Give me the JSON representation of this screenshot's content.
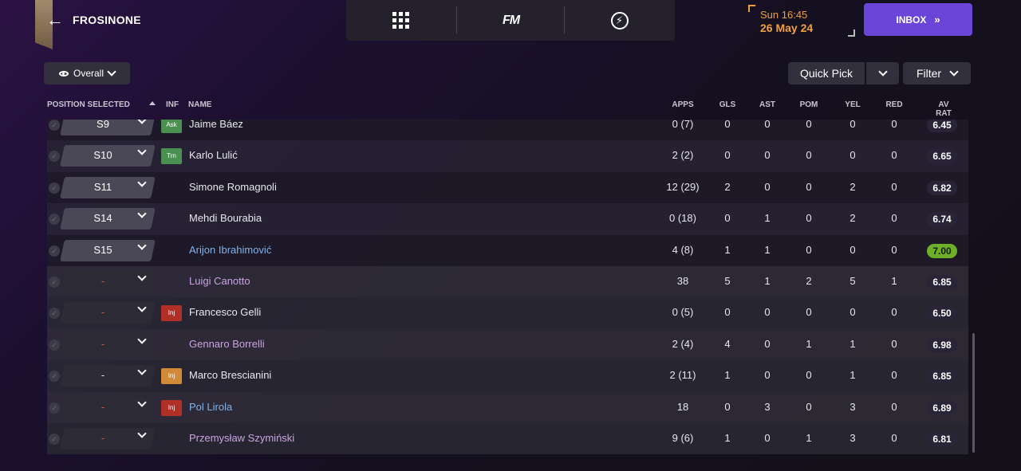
{
  "header": {
    "back_icon": "back-arrow-icon",
    "club_name": "FROSINONE",
    "nav": {
      "grid_icon": "grid-menu-icon",
      "logo": "FM",
      "bolt_icon": "lightning-icon"
    },
    "date_time": "Sun 16:45",
    "date_day": "26 May 24",
    "inbox_label": "INBOX",
    "colors": {
      "accent": "#6a45d8",
      "date": "#f0a040"
    }
  },
  "toolbar": {
    "view_label": "Overall",
    "quick_pick_label": "Quick Pick",
    "filter_label": "Filter"
  },
  "table": {
    "columns": {
      "position": "POSITION SELECTED",
      "inf": "INF",
      "name": "NAME",
      "apps": "APPS",
      "gls": "GLS",
      "ast": "AST",
      "pom": "POM",
      "yel": "YEL",
      "red": "RED",
      "avrat": "AV RAT"
    },
    "rows": [
      {
        "pos": "S9",
        "inf": "Ask",
        "name": "Jaime Báez",
        "apps": "0 (7)",
        "gls": "0",
        "ast": "0",
        "pom": "0",
        "yel": "0",
        "red": "0",
        "rat": "6.45"
      },
      {
        "pos": "S10",
        "inf": "Trn",
        "name": "Karlo Lulić",
        "apps": "2 (2)",
        "gls": "0",
        "ast": "0",
        "pom": "0",
        "yel": "0",
        "red": "0",
        "rat": "6.65"
      },
      {
        "pos": "S11",
        "inf": "",
        "name": "Simone Romagnoli",
        "apps": "12 (29)",
        "gls": "2",
        "ast": "0",
        "pom": "0",
        "yel": "2",
        "red": "0",
        "rat": "6.82"
      },
      {
        "pos": "S14",
        "inf": "",
        "name": "Mehdi Bourabia",
        "apps": "0 (18)",
        "gls": "0",
        "ast": "1",
        "pom": "0",
        "yel": "2",
        "red": "0",
        "rat": "6.74"
      },
      {
        "pos": "S15",
        "inf": "",
        "name": "Arijon Ibrahimović",
        "apps": "4 (8)",
        "gls": "1",
        "ast": "1",
        "pom": "0",
        "yel": "0",
        "red": "0",
        "rat": "7.00"
      },
      {
        "pos": "-",
        "inf": "",
        "name": "Luigi Canotto",
        "apps": "38",
        "gls": "5",
        "ast": "1",
        "pom": "2",
        "yel": "5",
        "red": "1",
        "rat": "6.85"
      },
      {
        "pos": "-",
        "inf": "Inj",
        "name": "Francesco Gelli",
        "apps": "0 (5)",
        "gls": "0",
        "ast": "0",
        "pom": "0",
        "yel": "0",
        "red": "0",
        "rat": "6.50"
      },
      {
        "pos": "-",
        "inf": "",
        "name": "Gennaro Borrelli",
        "apps": "2 (4)",
        "gls": "4",
        "ast": "0",
        "pom": "1",
        "yel": "1",
        "red": "0",
        "rat": "6.98"
      },
      {
        "pos": "-",
        "inf": "Inj",
        "name": "Marco Brescianini",
        "apps": "2 (11)",
        "gls": "1",
        "ast": "0",
        "pom": "0",
        "yel": "1",
        "red": "0",
        "rat": "6.85"
      },
      {
        "pos": "-",
        "inf": "Inj",
        "name": "Pol Lirola",
        "apps": "18",
        "gls": "0",
        "ast": "3",
        "pom": "0",
        "yel": "3",
        "red": "0",
        "rat": "6.89"
      },
      {
        "pos": "-",
        "inf": "",
        "name": "Przemysław Szymiński",
        "apps": "9 (6)",
        "gls": "1",
        "ast": "0",
        "pom": "1",
        "yel": "3",
        "red": "0",
        "rat": "6.81"
      }
    ]
  }
}
